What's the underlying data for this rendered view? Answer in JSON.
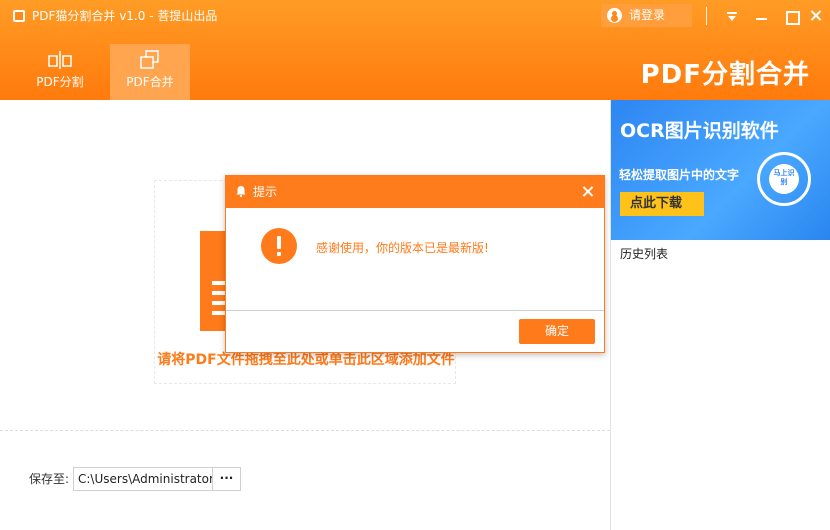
{
  "titlebar": {
    "title": "PDF猫分割合并 v1.0 - 菩提山出品",
    "login_label": "请登录"
  },
  "tabs": [
    {
      "label": "PDF分割"
    },
    {
      "label": "PDF合并"
    }
  ],
  "brand": "PDF分割合并",
  "drop_zone": {
    "text": "请将PDF文件拖拽至此处或单击此区域添加文件"
  },
  "save": {
    "label": "保存至:",
    "path": "C:\\Users\\Administrator",
    "browse_label": "···"
  },
  "ad": {
    "title": "OCR图片识别软件",
    "subtitle": "轻松提取图片中的文字",
    "button": "点此下载",
    "badge": "马上识别"
  },
  "history_label": "历史列表",
  "dialog": {
    "title": "提示",
    "message": "感谢使用，你的版本已是最新版!",
    "ok_label": "确定"
  },
  "colors": {
    "accent": "#ff7a1a",
    "ad_blue": "#2d86f2",
    "ad_button": "#ffc21a"
  }
}
